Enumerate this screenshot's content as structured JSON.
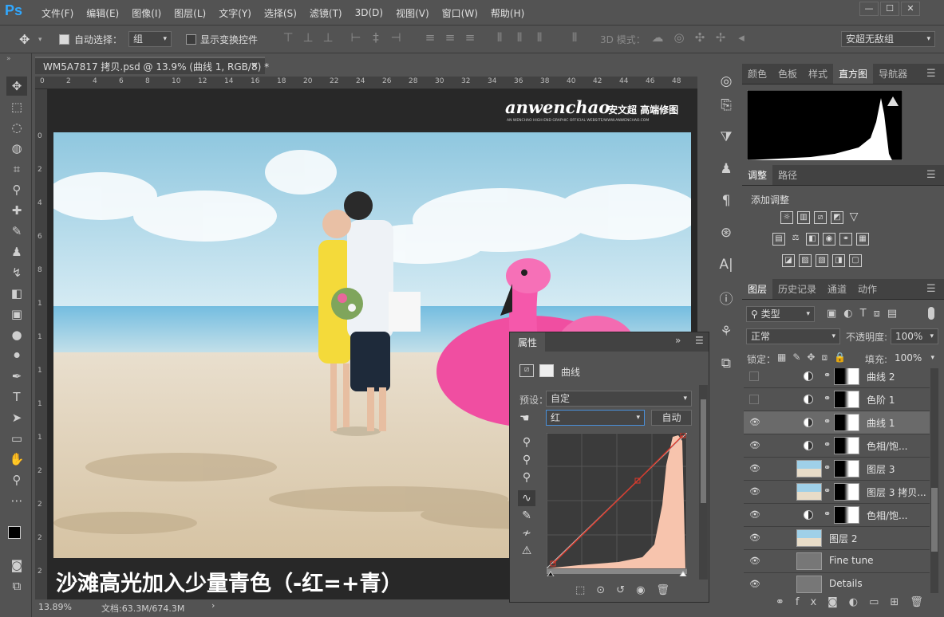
{
  "app": {
    "logo": "Ps"
  },
  "menu": [
    "文件(F)",
    "编辑(E)",
    "图像(I)",
    "图层(L)",
    "文字(Y)",
    "选择(S)",
    "滤镜(T)",
    "3D(D)",
    "视图(V)",
    "窗口(W)",
    "帮助(H)"
  ],
  "window_controls": {
    "minimize": "—",
    "maximize": "☐",
    "close": "✕"
  },
  "options": {
    "auto_select_label": "自动选择：",
    "auto_select_value": "组",
    "transform_label": "显示变换控件",
    "mode3d_label": "3D 模式：",
    "workspace": "安超无敌组"
  },
  "document": {
    "tab_title": "WM5A7817 拷贝.psd @ 13.9% (曲线 1, RGB/8) *",
    "close": "×"
  },
  "ruler_h": [
    "0",
    "2",
    "4",
    "6",
    "8",
    "10",
    "12",
    "14",
    "16",
    "18",
    "20",
    "22",
    "24",
    "26",
    "28",
    "30",
    "32",
    "34",
    "36",
    "38",
    "40",
    "42",
    "44",
    "46",
    "48"
  ],
  "ruler_v": [
    "0",
    "2",
    "4",
    "6",
    "8",
    "1",
    "1",
    "1",
    "1",
    "1",
    "2",
    "2",
    "2",
    "2"
  ],
  "watermark": {
    "brand": "anwenchao",
    "cn": "安文超 高端修图",
    "sub": "AN WENCHAO HIGH-END GRAPHIC OFFICIAL WEBSITE/WWW.ANWENCHAO.COM"
  },
  "caption": "沙滩高光加入少量青色（-红=+青）",
  "status": {
    "zoom": "13.89%",
    "doc": "文档:63.3M/674.3M",
    "arrow": "›"
  },
  "panels": {
    "top_tabs": [
      "颜色",
      "色板",
      "样式",
      "直方图",
      "导航器"
    ],
    "adjust_tabs": [
      "调整",
      "路径"
    ],
    "adjust_title": "添加调整",
    "layers_tabs": [
      "图层",
      "历史记录",
      "通道",
      "动作"
    ],
    "filter_label": "类型",
    "blend": "正常",
    "opacity_label": "不透明度:",
    "opacity": "100%",
    "lock_label": "锁定：",
    "fill_label": "填充:",
    "fill": "100%"
  },
  "layers": [
    {
      "name": "曲线 2",
      "visible": false,
      "kind": "adj"
    },
    {
      "name": "色阶 1",
      "visible": false,
      "kind": "adj"
    },
    {
      "name": "曲线 1",
      "visible": true,
      "kind": "adj",
      "selected": true
    },
    {
      "name": "色相/饱...",
      "visible": true,
      "kind": "adj"
    },
    {
      "name": "图层 3",
      "visible": true,
      "kind": "image"
    },
    {
      "name": "图层 3 拷贝...",
      "visible": true,
      "kind": "image"
    },
    {
      "name": "色相/饱...",
      "visible": true,
      "kind": "adj"
    },
    {
      "name": "图层 2",
      "visible": true,
      "kind": "image"
    },
    {
      "name": "Fine tune",
      "visible": true,
      "kind": "group"
    },
    {
      "name": "Details",
      "visible": true,
      "kind": "group"
    }
  ],
  "properties": {
    "title": "属性",
    "kind": "曲线",
    "preset_label": "预设：",
    "preset": "自定",
    "channel": "红",
    "auto": "自动"
  },
  "colors": {
    "accent": "#31a8ff",
    "panel": "#535353",
    "dark": "#424242",
    "curve": "#d9392b",
    "hist_fill": "#f7c4ad"
  }
}
